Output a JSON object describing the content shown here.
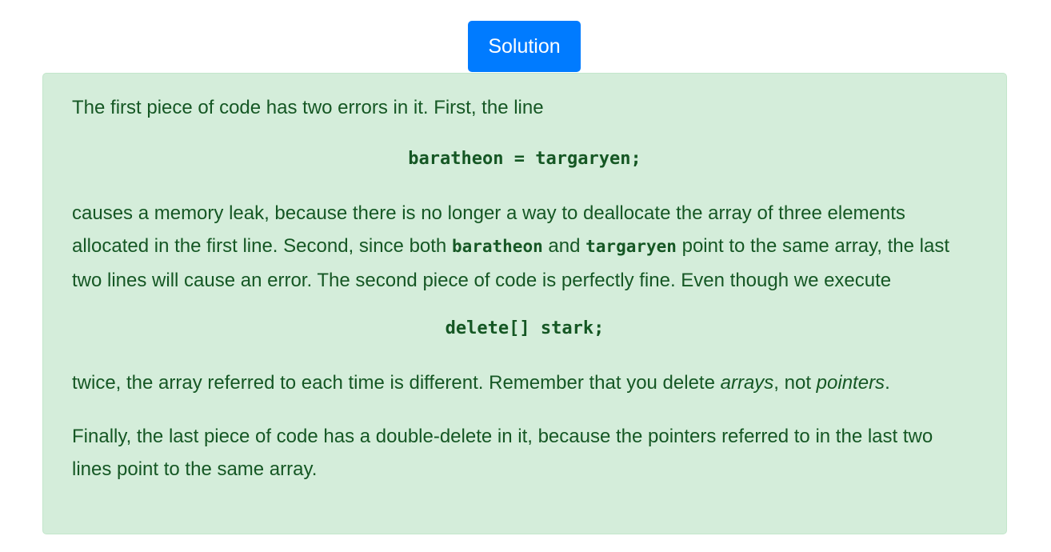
{
  "solution_button": {
    "label": "Solution"
  },
  "solution": {
    "p1": "The first piece of code has two errors in it. First, the line",
    "code1": "baratheon = targaryen;",
    "p2": {
      "part1": "causes a memory leak, because there is no longer a way to deallocate the array of three elements allocated in the first line. Second, since both ",
      "code_a": "baratheon",
      "part2": " and ",
      "code_b": "targaryen",
      "part3": " point to the same array, the last two lines will cause an error. The second piece of code is perfectly fine. Even though we execute"
    },
    "code2": "delete[] stark;",
    "p3": {
      "part1": "twice, the array referred to each time is different. Remember that you delete ",
      "em1": "arrays",
      "part2": ", not ",
      "em2": "pointers",
      "part3": "."
    },
    "p4": "Finally, the last piece of code has a double-delete in it, because the pointers referred to in the last two lines point to the same array."
  },
  "colors": {
    "button_bg": "#007bff",
    "box_bg": "#d4edda",
    "box_border": "#c3e6cb",
    "text": "#155724"
  }
}
